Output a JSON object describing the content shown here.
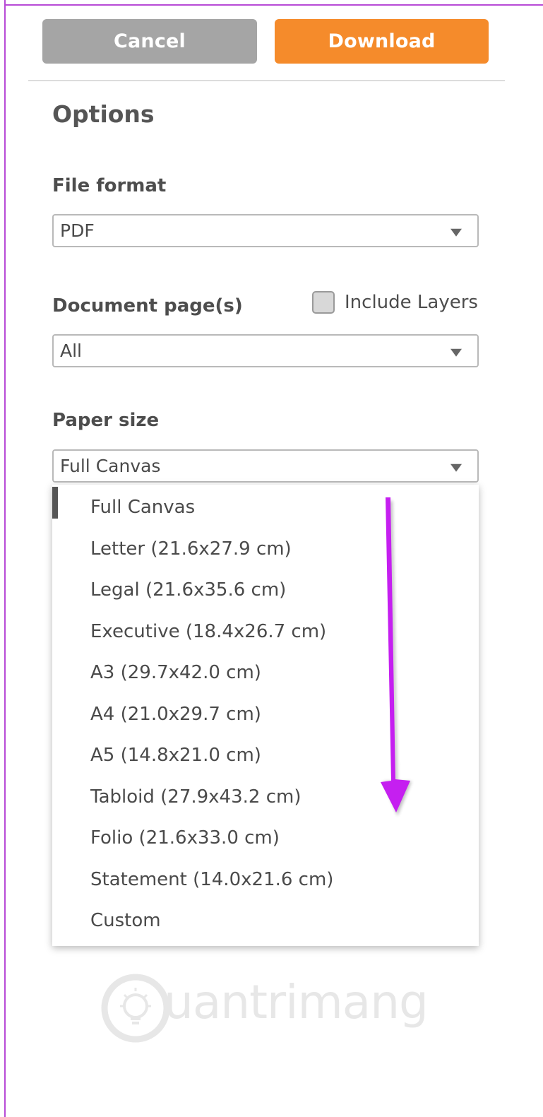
{
  "toolbar": {
    "cancel_label": "Cancel",
    "download_label": "Download"
  },
  "options": {
    "heading": "Options",
    "file_format": {
      "label": "File format",
      "value": "PDF"
    },
    "document_pages": {
      "label": "Document page(s)",
      "value": "All",
      "include_layers_label": "Include Layers",
      "include_layers_checked": false
    },
    "paper_size": {
      "label": "Paper size",
      "value": "Full Canvas",
      "options": [
        "Full Canvas",
        "Letter (21.6x27.9 cm)",
        "Legal (21.6x35.6 cm)",
        "Executive (18.4x26.7 cm)",
        "A3 (29.7x42.0 cm)",
        "A4 (21.0x29.7 cm)",
        "A5 (14.8x21.0 cm)",
        "Tabloid (27.9x43.2 cm)",
        "Folio (21.6x33.0 cm)",
        "Statement (14.0x21.6 cm)",
        "Custom"
      ]
    }
  },
  "watermark": {
    "text": "uantrimang"
  },
  "colors": {
    "cancel_bg": "#a5a5a5",
    "download_bg": "#f58b2b",
    "annotation_arrow": "#c51ff0",
    "frame_border": "#b84bd6"
  },
  "icons": {
    "select_caret": "caret-down-icon",
    "annotation_arrow": "arrow-down-icon",
    "watermark_logo": "lightbulb-icon"
  }
}
